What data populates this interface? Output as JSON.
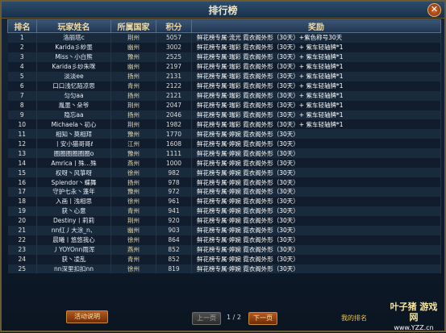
{
  "window": {
    "title": "排行榜",
    "close_icon": "✕"
  },
  "headers": [
    "排名",
    "玩家姓名",
    "所属国家",
    "积分",
    "奖励"
  ],
  "rows": [
    {
      "rank": "1",
      "name": "洛丽塔c",
      "nation": "荆州",
      "score": "5057",
      "reward": "鲜花榜专属·流光 霓衣阁外形（30天）+紫色称号30天"
    },
    {
      "rank": "2",
      "name": "Karida彡紗墨",
      "nation": "幽州",
      "score": "3002",
      "reward": "鲜花榜专属·瑞彩 霓衣阁外形（30天）+ 紫车轻轴牌*1"
    },
    {
      "rank": "3",
      "name": "Miss丶小白熊",
      "nation": "豫州",
      "score": "2525",
      "reward": "鲜花榜专属·瑞彩 霓衣阁外形（30天）+ 紫车轻轴牌*1"
    },
    {
      "rank": "4",
      "name": "Karida彡纱朱咪",
      "nation": "幽州",
      "score": "2197",
      "reward": "鲜花榜专属·瑞彩 霓衣阁外形（30天）+ 紫车轻轴牌*1"
    },
    {
      "rank": "5",
      "name": "淡淡ee",
      "nation": "扬州",
      "score": "2131",
      "reward": "鲜花榜专属·瑞彩 霓衣阁外形（30天）+ 紫车轻轴牌*1"
    },
    {
      "rank": "6",
      "name": "口口浅忆陌凉思",
      "nation": "青州",
      "score": "2122",
      "reward": "鲜花榜专属·瑞彩 霓衣阁外形（30天）+ 紫车轻轴牌*1"
    },
    {
      "rank": "7",
      "name": "匀匀aa",
      "nation": "扬州",
      "score": "2121",
      "reward": "鲜花榜专属·瑞彩 霓衣阁外形（30天）+ 紫车轻轴牌*1"
    },
    {
      "rank": "8",
      "name": "胤墨丶朵爷",
      "nation": "荆州",
      "score": "2047",
      "reward": "鲜花榜专属·瑞彩 霓衣阁外形（30天）+ 紫车轻轴牌*1"
    },
    {
      "rank": "9",
      "name": "隐忘aa",
      "nation": "扬州",
      "score": "2046",
      "reward": "鲜花榜专属·瑞彩 霓衣阁外形（30天）+ 紫车轻轴牌*1"
    },
    {
      "rank": "10",
      "name": "Michaela丶初心",
      "nation": "荆州",
      "score": "1982",
      "reward": "鲜花榜专属·瑞彩 霓衣阁外形（30天）+ 紫车轻轴牌*1"
    },
    {
      "rank": "11",
      "name": "相知丶莫相拜",
      "nation": "豫州",
      "score": "1770",
      "reward": "鲜花榜专属·婷婉 霓衣阁外形（30天）"
    },
    {
      "rank": "12",
      "name": "丨安小猫哥哥ℓ",
      "nation": "江州",
      "score": "1608",
      "reward": "鲜花榜专属·婷婉 霓衣阁外形（30天）"
    },
    {
      "rank": "13",
      "name": "圈圈圈圈圈圈o",
      "nation": "豫州",
      "score": "1111",
      "reward": "鲜花榜专属·婷婉 霓衣阁外形（30天）"
    },
    {
      "rank": "14",
      "name": "Amrica丨殊…殊",
      "nation": "燕州",
      "score": "1000",
      "reward": "鲜花榜专属·婷婉 霓衣阁外形（30天）"
    },
    {
      "rank": "15",
      "name": "权呀丶风箏呀",
      "nation": "徐州",
      "score": "982",
      "reward": "鲜花榜专属·婷婉 霓衣阁外形（30天）"
    },
    {
      "rank": "16",
      "name": "Splendor丶蝶舞",
      "nation": "扬州",
      "score": "978",
      "reward": "鲜花榜专属·婷婉 霓衣阁外形（30天）"
    },
    {
      "rank": "17",
      "name": "守护七永丶蓬年",
      "nation": "豫州",
      "score": "972",
      "reward": "鲜花榜专属·婷婉 霓衣阁外形（30天）"
    },
    {
      "rank": "18",
      "name": "入画丨浅相思",
      "nation": "徐州",
      "score": "961",
      "reward": "鲜花榜专属·婷婉 霓衣阁外形（30天）"
    },
    {
      "rank": "19",
      "name": "获丶心意",
      "nation": "青州",
      "score": "941",
      "reward": "鲜花榜专属·婷婉 霓衣阁外形（30天）"
    },
    {
      "rank": "20",
      "name": "Destiny丨莉莉",
      "nation": "荆州",
      "score": "920",
      "reward": "鲜花榜专属·婷婉 霓衣阁外形（30天）"
    },
    {
      "rank": "21",
      "name": "nn红丿大涂_n、",
      "nation": "幽州",
      "score": "903",
      "reward": "鲜花榜专属·婷婉 霓衣阁外形（30天）"
    },
    {
      "rank": "22",
      "name": "晨曦丨悠悠我心",
      "nation": "徐州",
      "score": "864",
      "reward": "鲜花榜专属·婷婉 霓衣阁外形（30天）"
    },
    {
      "rank": "23",
      "name": "丿YOYOnn雨浑",
      "nation": "燕州",
      "score": "852",
      "reward": "鲜花榜专属·婷婉 霓衣阁外形（30天）"
    },
    {
      "rank": "24",
      "name": "获丶凌乱",
      "nation": "青州",
      "score": "852",
      "reward": "鲜花榜专属·婷婉 霓衣阁外形（30天）"
    },
    {
      "rank": "25",
      "name": "nn深里扣扣nn",
      "nation": "徐州",
      "score": "819",
      "reward": "鲜花榜专属·婷婉 霓衣阁外形（30天）"
    }
  ],
  "footer": {
    "activity_button": "活动说明",
    "prev_button": "上一页",
    "page_info": "1 / 2",
    "next_button": "下一页",
    "my_rank_label": "我的排名"
  },
  "watermark": {
    "line1": "叶子猪 游戏网",
    "line2": "www.YZZ.cn"
  }
}
